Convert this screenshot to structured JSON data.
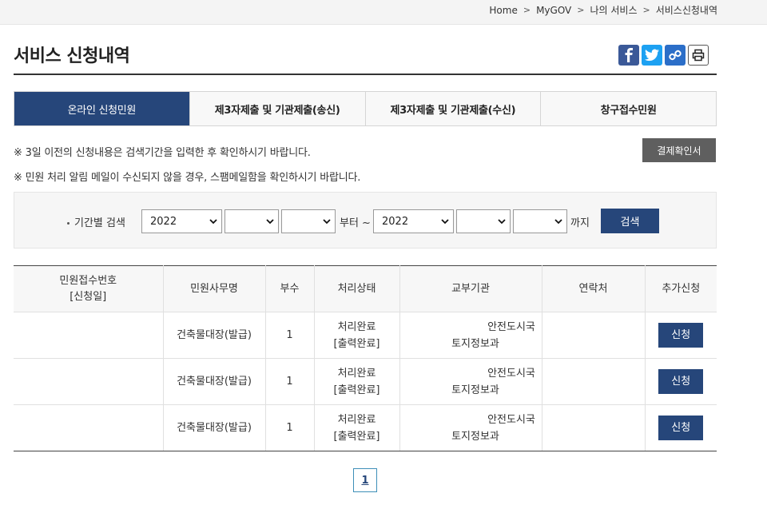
{
  "breadcrumb": [
    "Home",
    "MyGOV",
    "나의 서비스",
    "서비스신청내역"
  ],
  "page_title": "서비스 신청내역",
  "share_icons": [
    "facebook-icon",
    "twitter-icon",
    "link-icon",
    "print-icon"
  ],
  "tabs": [
    {
      "label": "온라인 신청민원",
      "active": true
    },
    {
      "label": "제3자제출 및 기관제출(송신)",
      "active": false
    },
    {
      "label": "제3자제출 및 기관제출(수신)",
      "active": false
    },
    {
      "label": "창구접수민원",
      "active": false
    }
  ],
  "notices": [
    "※ 3일 이전의 신청내용은 검색기간을 입력한 후 확인하시기 바랍니다.",
    "※ 민원 처리 알림 메일이 수신되지 않을 경우, 스팸메일함을 확인하시기 바랍니다."
  ],
  "confirm_button": "결제확인서",
  "search": {
    "label": "기간별 검색",
    "from_year": "2022",
    "from_month": "",
    "from_day": "",
    "from_suffix": "부터 ~",
    "to_year": "2022",
    "to_month": "",
    "to_day": "",
    "to_suffix": "까지",
    "button": "검색"
  },
  "table": {
    "headers": {
      "receipt_no": "민원접수번호",
      "receipt_sub": "[신청일]",
      "service": "민원사무명",
      "copies": "부수",
      "status": "처리상태",
      "agency": "교부기관",
      "contact": "연락처",
      "extra": "추가신청"
    },
    "rows": [
      {
        "receipt": "",
        "service": "건축물대장(발급)",
        "copies": "1",
        "status1": "처리완료",
        "status2": "[출력완료]",
        "agency1": "안전도시국",
        "agency2": "토지정보과",
        "contact": "",
        "action": "신청"
      },
      {
        "receipt": "",
        "service": "건축물대장(발급)",
        "copies": "1",
        "status1": "처리완료",
        "status2": "[출력완료]",
        "agency1": "안전도시국",
        "agency2": "토지정보과",
        "contact": "",
        "action": "신청"
      },
      {
        "receipt": "",
        "service": "건축물대장(발급)",
        "copies": "1",
        "status1": "처리완료",
        "status2": "[출력완료]",
        "agency1": "안전도시국",
        "agency2": "토지정보과",
        "contact": "",
        "action": "신청"
      }
    ]
  },
  "pagination": {
    "current": "1"
  },
  "colors": {
    "primary": "#26467a",
    "dark_button": "#5f5f5f",
    "pager_border": "#3e8fb8"
  }
}
